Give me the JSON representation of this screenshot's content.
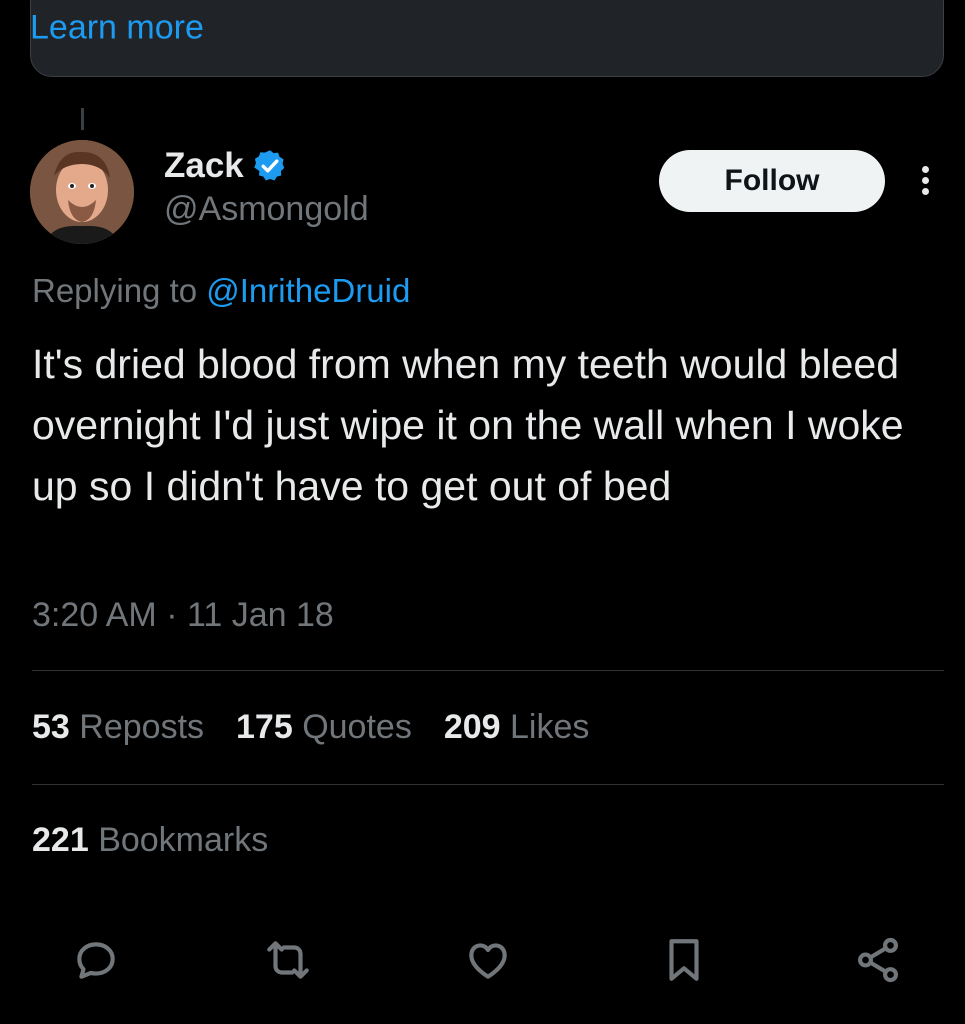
{
  "note": {
    "learn_more": "Learn more"
  },
  "author": {
    "name": "Zack",
    "handle": "@Asmongold",
    "verified": true,
    "follow_label": "Follow"
  },
  "reply": {
    "prefix": "Replying to ",
    "mention": "@InritheDruid"
  },
  "tweet": {
    "text": "It's dried blood from when my teeth would bleed overnight I'd just wipe it on the wall when I woke up so I didn't have to get out of bed",
    "timestamp": "3:20 AM · 11 Jan 18"
  },
  "stats": {
    "reposts_count": "53",
    "reposts_label": "Reposts",
    "quotes_count": "175",
    "quotes_label": "Quotes",
    "likes_count": "209",
    "likes_label": "Likes",
    "bookmarks_count": "221",
    "bookmarks_label": "Bookmarks"
  },
  "actions": [
    "reply-icon",
    "repost-icon",
    "like-icon",
    "bookmark-icon",
    "share-icon"
  ],
  "colors": {
    "accent": "#1d9bf0",
    "background": "#000000",
    "muted": "#71767b"
  }
}
